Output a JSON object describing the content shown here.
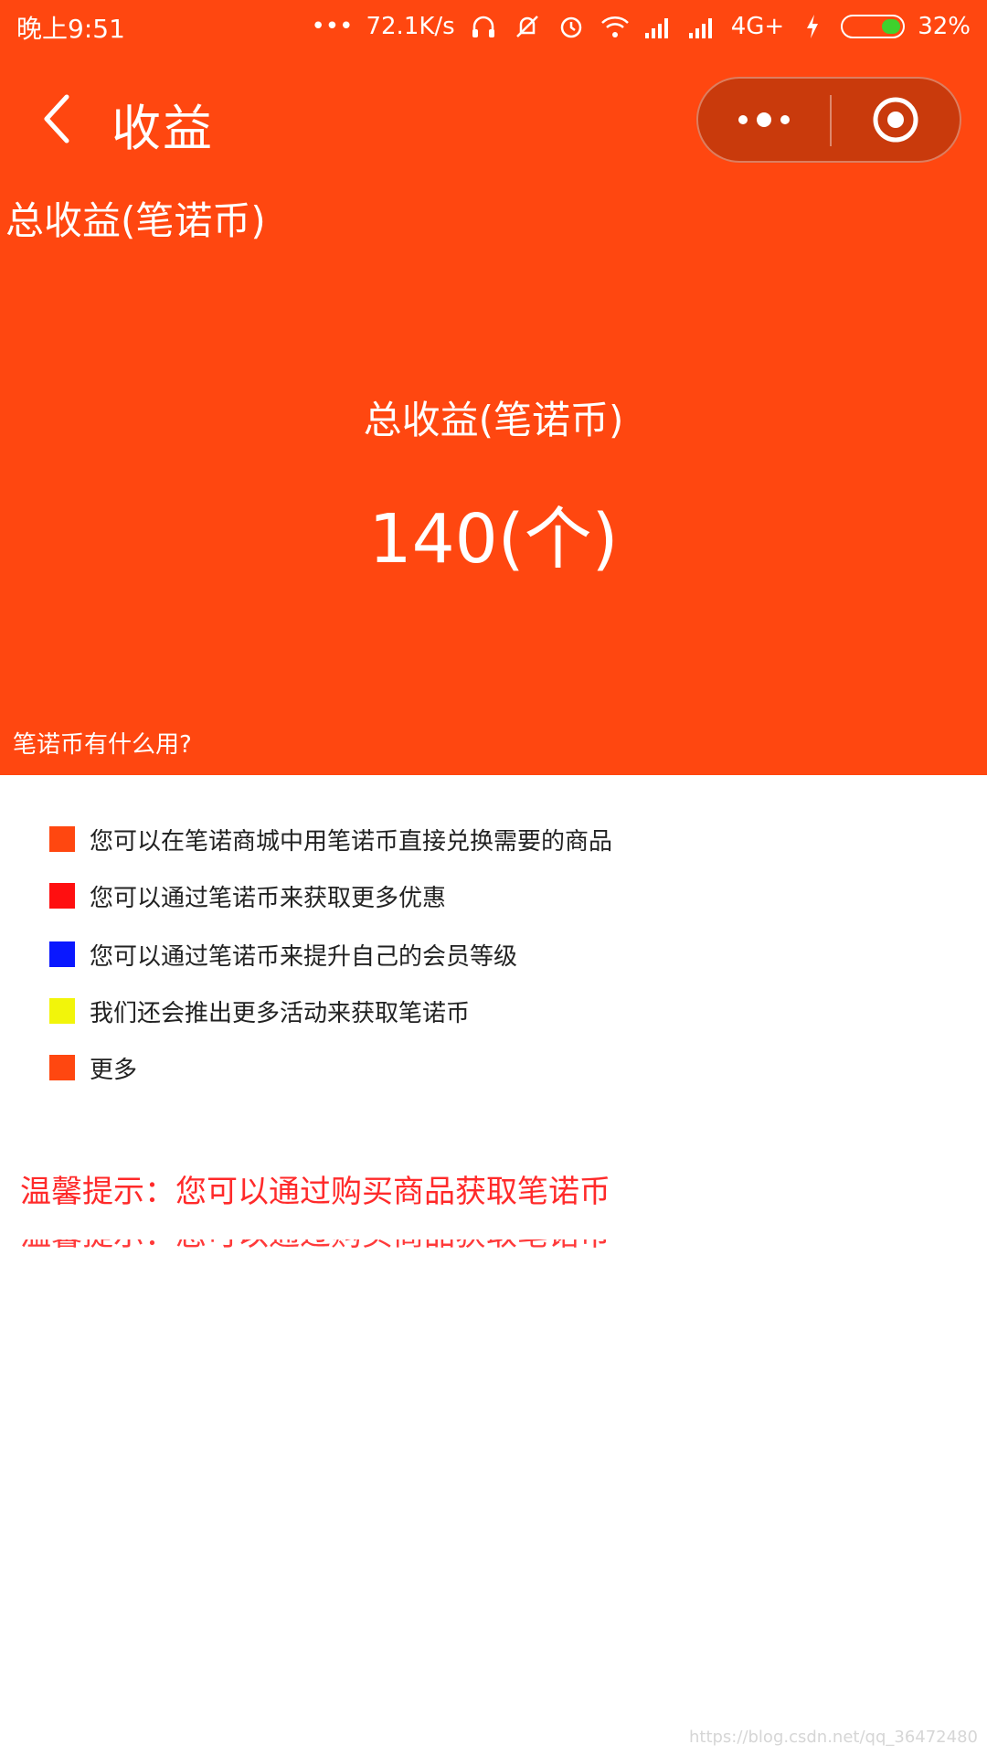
{
  "status_bar": {
    "time": "晚上9:51",
    "network_speed": "72.1K/s",
    "network_type": "4G+",
    "battery_percent": "32%",
    "battery_level": 0.32
  },
  "nav": {
    "title": "收益",
    "icons": {
      "back": "chevron-left-icon",
      "more": "more-dots-icon",
      "close": "target-circle-icon"
    }
  },
  "summary": {
    "section_label": "总收益(笔诺币)",
    "total_label": "总收益(笔诺币)",
    "total_value": "140(个)",
    "usage_question": "笔诺币有什么用?"
  },
  "benefits": [
    {
      "text": "您可以在笔诺商城中用笔诺币直接兑换需要的商品",
      "color": "#ff4710"
    },
    {
      "text": "您可以通过笔诺币来获取更多优惠",
      "color": "#ff0f10"
    },
    {
      "text": "您可以通过笔诺币来提升自己的会员等级",
      "color": "#0a18ff"
    },
    {
      "text": "我们还会推出更多活动来获取笔诺币",
      "color": "#f2f50a"
    },
    {
      "text": "更多",
      "color": "#ff4710"
    }
  ],
  "tip": {
    "text": "温馨提示：您可以通过购买商品获取笔诺币"
  },
  "watermark": "https://blog.csdn.net/qq_36472480",
  "colors": {
    "header_bg": "#ff4710",
    "capsule_bg": "#c93a0c",
    "tip_red": "#ff2a2a"
  }
}
